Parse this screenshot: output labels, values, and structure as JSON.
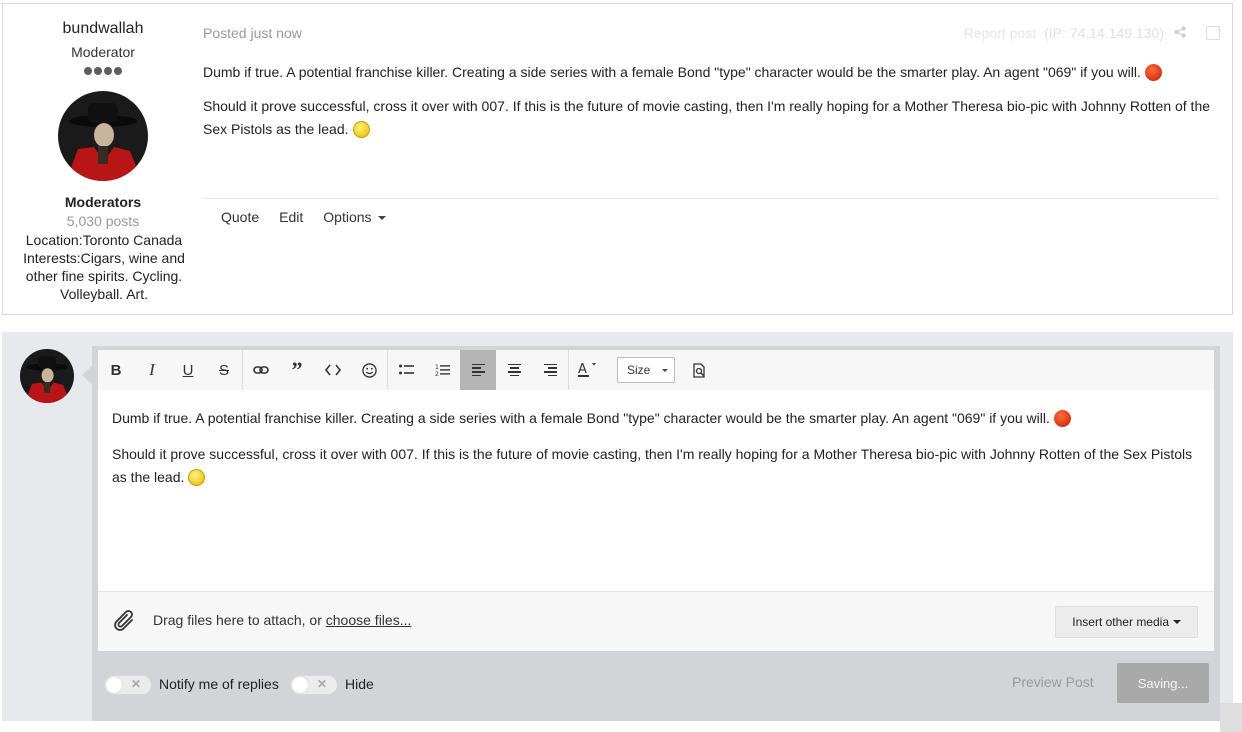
{
  "author": {
    "name": "bundwallah",
    "title": "Moderator",
    "group": "Moderators",
    "posts": "5,030 posts",
    "location": "Location:Toronto Canada",
    "interests": "Interests:Cigars, wine and other fine spirits. Cycling. Volleyball. Art."
  },
  "post": {
    "meta": "Posted just now",
    "report": "Report post",
    "ip": "(IP: 74.14.149.130)",
    "paragraph1": "Dumb if true.  A potential franchise killer.  Creating a side series with a female Bond \"type\" character would be the smarter play. An agent \"069\" if you will.",
    "paragraph2": "Should it prove successful, cross it over with 007.  If this is the future of movie casting, then I'm really hoping for a  Mother Theresa bio-pic with Johnny Rotten of the Sex Pistols as the lead.",
    "controls": {
      "quote": "Quote",
      "edit": "Edit",
      "options": "Options"
    }
  },
  "editor": {
    "toolbar": {
      "size": "Size"
    },
    "content": {
      "paragraph1": "Dumb if true.  A potential franchise killer.  Creating a side series with a female Bond \"type\" character would be the smarter play. An agent \"069\" if you will.",
      "paragraph2": "Should it prove successful, cross it over with 007.  If this is the future of movie casting, then I'm really hoping for a  Mother Theresa bio-pic with Johnny Rotten of the Sex Pistols as the lead."
    },
    "attach": {
      "text": "Drag files here to attach, or ",
      "link": "choose files...",
      "insert_media": "Insert other media"
    },
    "notify_label": "Notify me of replies",
    "hide_label": "Hide",
    "preview": "Preview Post",
    "submit": "Saving..."
  },
  "icons": {
    "active_align": "align-left-icon",
    "emoji1": "devil-emoji",
    "emoji2": "smile-emoji"
  },
  "colors": {
    "active_button": "#b5b5b5",
    "reply_bg": "#e8e9ec",
    "submit_bg": "#a9a9a9"
  }
}
